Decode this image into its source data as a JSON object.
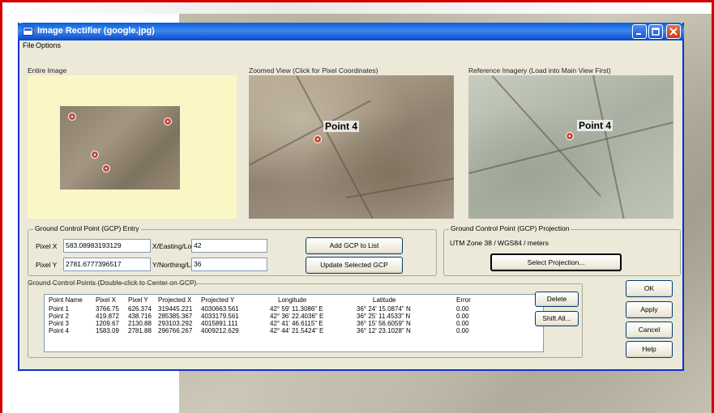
{
  "window": {
    "title": "Image Rectifier (google.jpg)"
  },
  "menu": [
    "File",
    "Options"
  ],
  "panels": {
    "entire_image_label": "Entire Image",
    "zoomed_view_label": "Zoomed View (Click for Pixel Coordinates)",
    "reference_label": "Reference Imagery (Load into Main View First)",
    "point_label": "Point 4"
  },
  "gcp_entry": {
    "title": "Ground Control Point (GCP) Entry",
    "pixel_x_label": "Pixel X",
    "pixel_x_value": "583.08983193129",
    "pixel_y_label": "Pixel Y",
    "pixel_y_value": "2781.6777396517",
    "easting_label": "X/Easting/Lon",
    "easting_value": "42",
    "northing_label": "Y/Northing/Lat",
    "northing_value": "36",
    "add_button": "Add GCP to List",
    "update_button": "Update Selected GCP"
  },
  "projection": {
    "title": "Ground Control Point (GCP) Projection",
    "text": "UTM Zone 38 / WGS84 / meters",
    "select_button": "Select Projection..."
  },
  "gcp_list": {
    "title": "Ground Control Points (Double-click to Center on GCP)",
    "headers": [
      "Point Name",
      "Pixel X",
      "Pixel Y",
      "Projected X",
      "Projected Y",
      "Longitude",
      "Latitude",
      "Error"
    ],
    "rows": [
      [
        "Point 1",
        "3766.75",
        "626.374",
        "319445.221",
        "4030663.561",
        "42° 59' 11.3086\" E",
        "36° 24' 15.0874\" N",
        "0.00"
      ],
      [
        "Point 2",
        "419.872",
        "438.716",
        "285385.367",
        "4033179.561",
        "42° 36' 22.4036\" E",
        "36° 25' 11.4533\" N",
        "0.00"
      ],
      [
        "Point 3",
        "1209.67",
        "2130.88",
        "293103.292",
        "4015891.111",
        "42° 41' 46.6115\" E",
        "36° 15' 56.6059\" N",
        "0.00"
      ],
      [
        "Point 4",
        "1583.09",
        "2781.88",
        "296766.267",
        "4009212.629",
        "42° 44' 21.5424\" E",
        "36° 12' 23.1028\" N",
        "0.00"
      ]
    ]
  },
  "side_buttons": {
    "delete": "Delete",
    "shift_all": "Shift All...",
    "ok": "OK",
    "apply": "Apply",
    "cancel": "Cancel",
    "help": "Help"
  }
}
